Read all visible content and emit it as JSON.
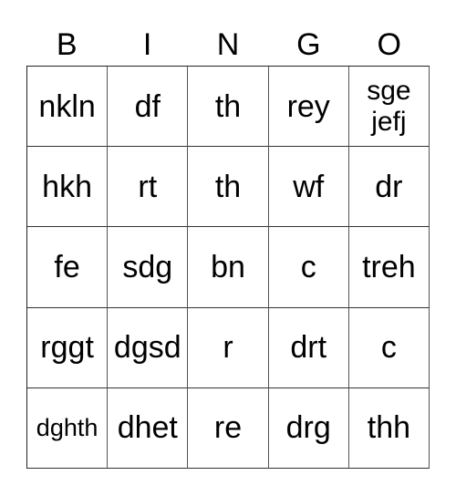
{
  "header": [
    "B",
    "I",
    "N",
    "G",
    "O"
  ],
  "rows": [
    [
      "nkln",
      "df",
      "th",
      "rey",
      "sge\njefj"
    ],
    [
      "hkh",
      "rt",
      "th",
      "wf",
      "dr"
    ],
    [
      "fe",
      "sdg",
      "bn",
      "c",
      "treh"
    ],
    [
      "rggt",
      "dgsd",
      "r",
      "drt",
      "c"
    ],
    [
      "dghth",
      "dhet",
      "re",
      "drg",
      "thh"
    ]
  ]
}
